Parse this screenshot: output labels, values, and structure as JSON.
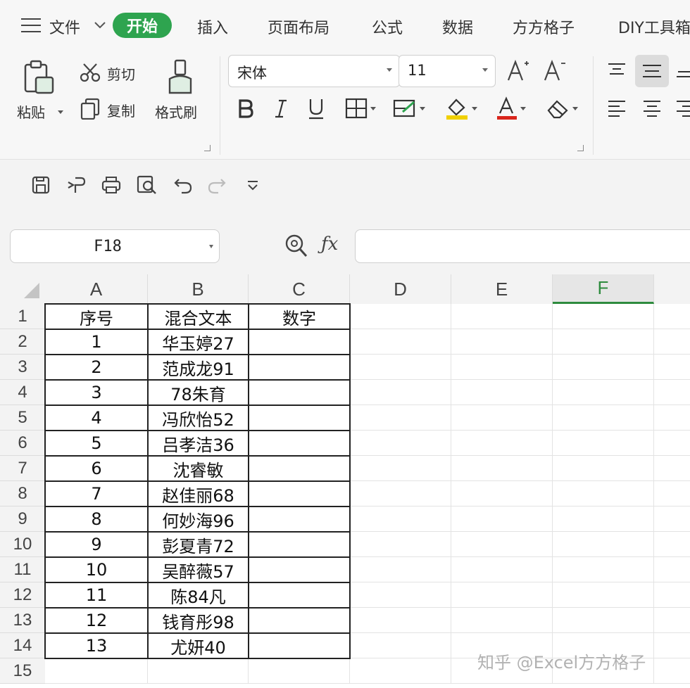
{
  "menu": {
    "items": [
      "文件",
      "开始",
      "插入",
      "页面布局",
      "公式",
      "数据",
      "方方格子",
      "DIY工具箱"
    ],
    "active_index": 1
  },
  "ribbon": {
    "paste_label": "粘贴",
    "cut_label": "剪切",
    "copy_label": "复制",
    "format_painter_label": "格式刷",
    "font_name": "宋体",
    "font_size": "11"
  },
  "formula_bar": {
    "name_box": "F18",
    "formula_value": ""
  },
  "sheet": {
    "columns": [
      "A",
      "B",
      "C",
      "D",
      "E",
      "F"
    ],
    "selected_column": "F",
    "rows": [
      "1",
      "2",
      "3",
      "4",
      "5",
      "6",
      "7",
      "8",
      "9",
      "10",
      "11",
      "12",
      "13",
      "14",
      "15"
    ],
    "headers": [
      "序号",
      "混合文本",
      "数字"
    ],
    "data": [
      [
        "1",
        "华玉婷27",
        ""
      ],
      [
        "2",
        "范成龙91",
        ""
      ],
      [
        "3",
        "78朱育",
        ""
      ],
      [
        "4",
        "冯欣怡52",
        ""
      ],
      [
        "5",
        "吕孝洁36",
        ""
      ],
      [
        "6",
        "沈睿敏",
        ""
      ],
      [
        "7",
        "赵佳丽68",
        ""
      ],
      [
        "8",
        "何妙海96",
        ""
      ],
      [
        "9",
        "彭夏青72",
        ""
      ],
      [
        "10",
        "吴醉薇57",
        ""
      ],
      [
        "11",
        "陈84凡",
        ""
      ],
      [
        "12",
        "钱育彤98",
        ""
      ],
      [
        "13",
        "尤妍40",
        ""
      ]
    ]
  },
  "watermark": "知乎 @Excel方方格子",
  "colors": {
    "accent": "#2ea44f",
    "selected_col": "#2e8b3e"
  }
}
